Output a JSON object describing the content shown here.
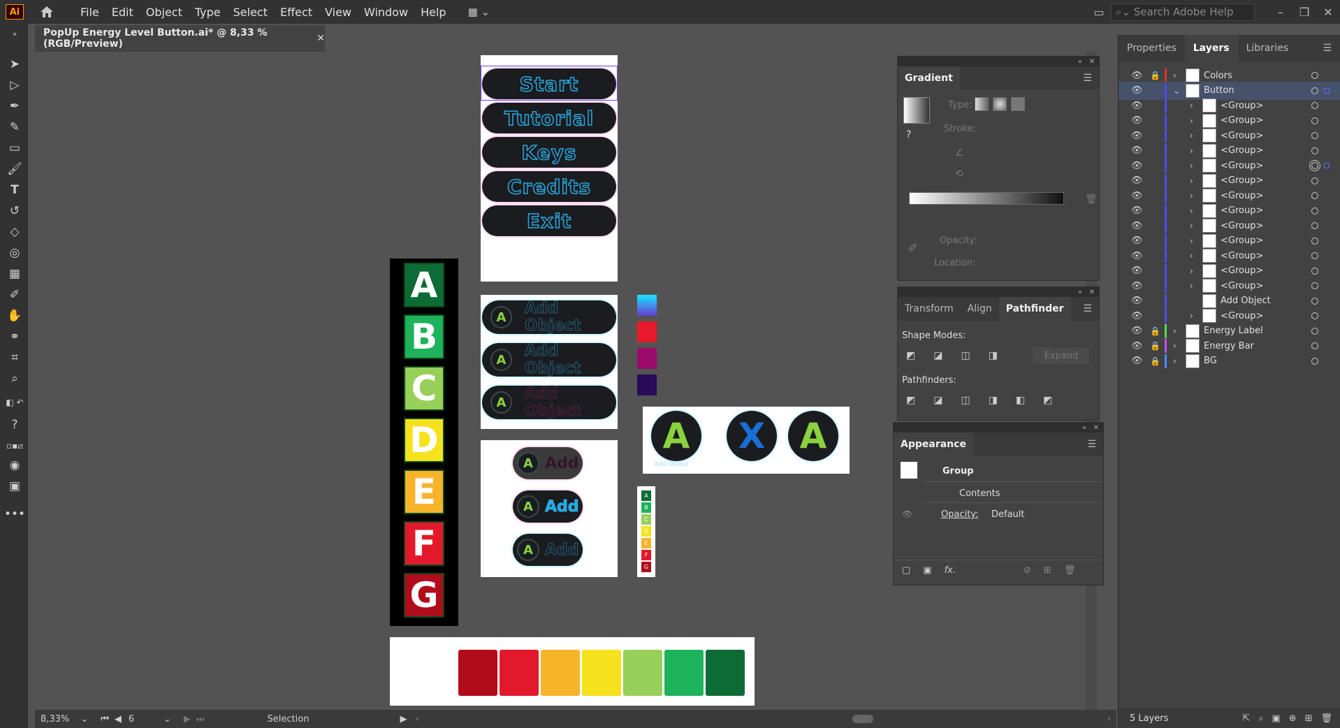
{
  "app": {
    "logo": "Ai",
    "menus": [
      "File",
      "Edit",
      "Object",
      "Type",
      "Select",
      "Effect",
      "View",
      "Window",
      "Help"
    ],
    "search_placeholder": "Search Adobe Help"
  },
  "document": {
    "tab_title": "PopUp Energy Level Button.ai* @ 8,33 % (RGB/Preview)"
  },
  "artwork": {
    "menu_buttons": [
      "Start",
      "Tutorial",
      "Keys",
      "Credits",
      "Exit"
    ],
    "energy_letters": [
      "A",
      "B",
      "C",
      "D",
      "E",
      "F",
      "G"
    ],
    "energy_colors": [
      "#0d6b35",
      "#1db25b",
      "#98cf58",
      "#f5e21c",
      "#f7b42b",
      "#e3182b",
      "#b10c1c"
    ],
    "energy_bar_colors": [
      "#b10c1c",
      "#e3182b",
      "#f7b42b",
      "#f5e21c",
      "#98cf58",
      "#1db25b",
      "#0d6b35"
    ],
    "add_object_label": "Add Object",
    "add_label": "Add",
    "circle_a": "A",
    "circle_x": "X",
    "swatch_colors": [
      "#6a3bd6",
      "#e8192c",
      "#9c0a6b",
      "#2a0a5a"
    ],
    "mini_label_letters": [
      "A",
      "B",
      "C",
      "D",
      "E",
      "F",
      "G"
    ]
  },
  "gradient_panel": {
    "title": "Gradient",
    "type_label": "Type:",
    "stroke_label": "Stroke:",
    "opacity_label": "Opacity:",
    "location_label": "Location:"
  },
  "pathfinder_panel": {
    "tabs": [
      "Transform",
      "Align",
      "Pathfinder"
    ],
    "shape_modes_label": "Shape Modes:",
    "pathfinders_label": "Pathfinders:",
    "expand_label": "Expand"
  },
  "appearance_panel": {
    "title": "Appearance",
    "group_label": "Group",
    "contents_label": "Contents",
    "opacity_label": "Opacity:",
    "opacity_value": "Default",
    "fx_label": "fx."
  },
  "layers_panel": {
    "tabs": [
      "Properties",
      "Layers",
      "Libraries"
    ],
    "rows": [
      {
        "name": "Colors",
        "color": "#e0332f",
        "level": 0,
        "locked": true,
        "expanded": false,
        "selected": false
      },
      {
        "name": "Button",
        "color": "#4b4bff",
        "level": 0,
        "locked": false,
        "expanded": true,
        "selected": true
      },
      {
        "name": "<Group>",
        "color": "#4b4bff",
        "level": 1
      },
      {
        "name": "<Group>",
        "color": "#4b4bff",
        "level": 1
      },
      {
        "name": "<Group>",
        "color": "#4b4bff",
        "level": 1
      },
      {
        "name": "<Group>",
        "color": "#4b4bff",
        "level": 1
      },
      {
        "name": "<Group>",
        "color": "#4b4bff",
        "level": 1,
        "targeted": true
      },
      {
        "name": "<Group>",
        "color": "#4b4bff",
        "level": 1
      },
      {
        "name": "<Group>",
        "color": "#4b4bff",
        "level": 1
      },
      {
        "name": "<Group>",
        "color": "#4b4bff",
        "level": 1
      },
      {
        "name": "<Group>",
        "color": "#4b4bff",
        "level": 1
      },
      {
        "name": "<Group>",
        "color": "#4b4bff",
        "level": 1
      },
      {
        "name": "<Group>",
        "color": "#4b4bff",
        "level": 1
      },
      {
        "name": "<Group>",
        "color": "#4b4bff",
        "level": 1
      },
      {
        "name": "<Group>",
        "color": "#4b4bff",
        "level": 1
      },
      {
        "name": "Add Object",
        "color": "#4b4bff",
        "level": 1,
        "noTwist": true
      },
      {
        "name": "<Group>",
        "color": "#4b4bff",
        "level": 1
      },
      {
        "name": "Energy Label",
        "color": "#4fe34f",
        "level": 0,
        "locked": true
      },
      {
        "name": "Energy Bar",
        "color": "#c84bff",
        "level": 0,
        "locked": true
      },
      {
        "name": "BG",
        "color": "#4b8bff",
        "level": 0,
        "locked": true
      }
    ],
    "footer_count": "5 Layers"
  },
  "status": {
    "zoom": "8,33%",
    "artboard": "6",
    "tool": "Selection"
  }
}
